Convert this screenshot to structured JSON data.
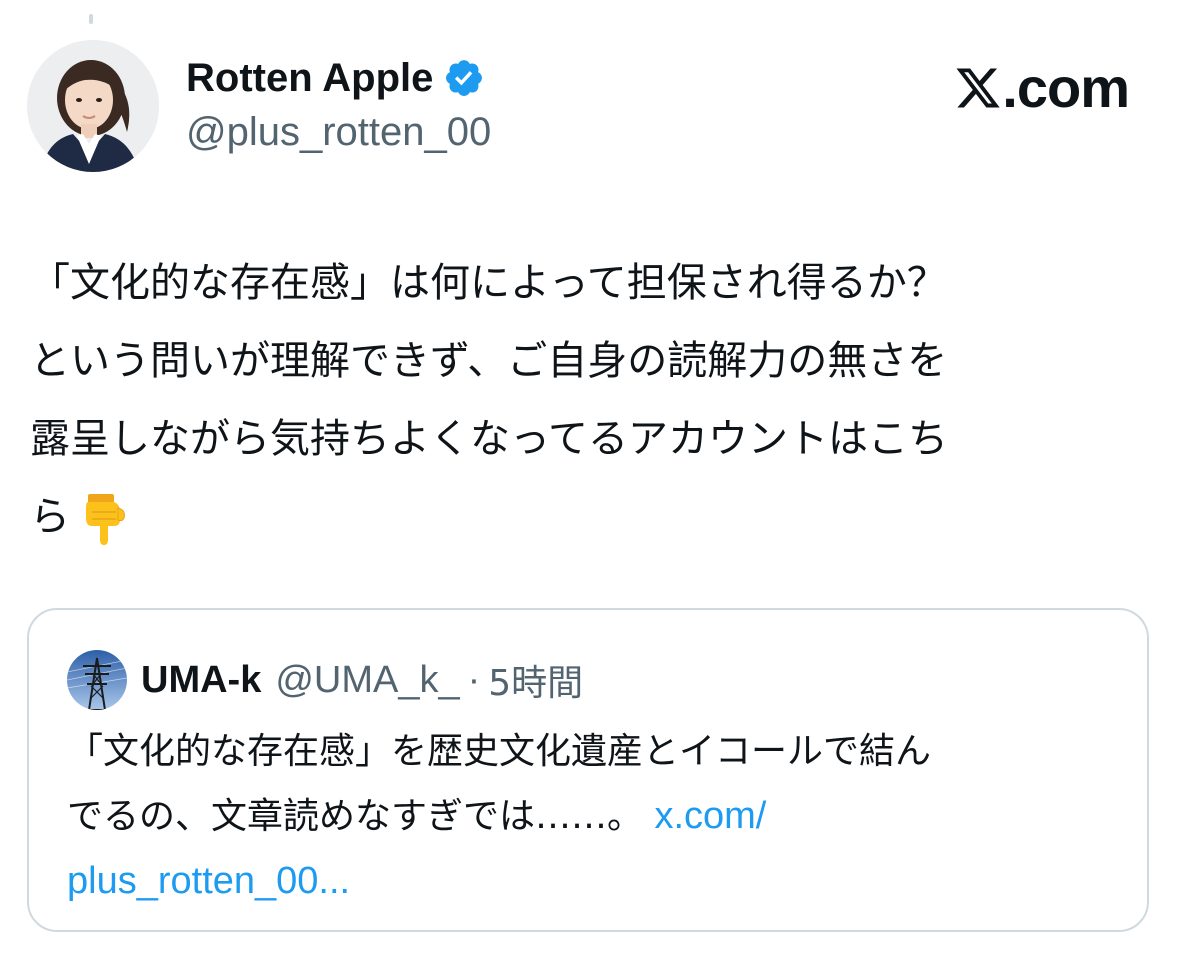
{
  "brand": {
    "text": ".com",
    "logo_icon": "x-logo-icon"
  },
  "author": {
    "name": "Rotten Apple",
    "handle": "@plus_rotten_00",
    "verified_icon": "verified-badge-icon",
    "verified_color": "#1d9bf0"
  },
  "tweet": {
    "text": "「文化的な存在感」は何によって担保され得るか？\nという問いが理解できず、ご自身の読解力の無さを\n露呈しながら気持ちよくなってるアカウントはこち\nら",
    "emoji_icon": "pointing-down-hand-icon"
  },
  "quote": {
    "name": "UMA-k",
    "handle": "@UMA_k_",
    "separator": "·",
    "time": "5時間",
    "text": "「文化的な存在感」を歴史文化遺産とイコールで結ん\nでるの、文章読めなすぎでは……。 ",
    "link_line1": "x.com/",
    "link_line2": "plus_rotten_00...",
    "avatar_icon": "power-tower-avatar-icon"
  },
  "colors": {
    "text_primary": "#0f1419",
    "text_secondary": "#536471",
    "link": "#1d9bf0",
    "border": "#cfd9de"
  }
}
